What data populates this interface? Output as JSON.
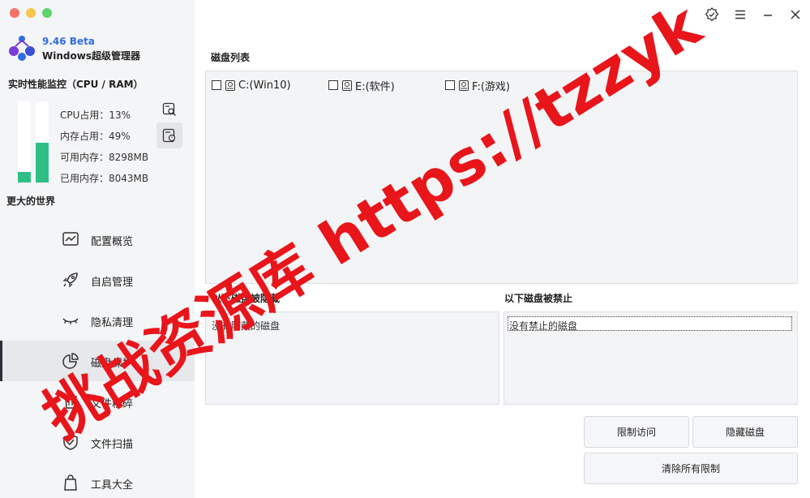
{
  "app": {
    "version": "9.46 Beta",
    "name": "Windows超级管理器"
  },
  "colors": {
    "accent": "#2f6de1",
    "meter_fill": "#2fbf85",
    "watermark": "#e8151b",
    "traffic_close": "#f3736a",
    "traffic_min": "#f6c54c",
    "traffic_max": "#5fd36e"
  },
  "monitor": {
    "title": "实时性能监控（CPU / RAM）",
    "cpu_fraction": 0.13,
    "ram_fraction": 0.49,
    "cpu_text": "CPU占用：13%",
    "ram_text": "内存占用：49%",
    "free_text": "可用内存：8298MB",
    "used_text": "已用内存：8043MB",
    "icon_1": "disk-search-icon",
    "icon_2": "disk-check-icon"
  },
  "sidebar": {
    "slogan": "更大的世界",
    "items": [
      {
        "label": "配置概览",
        "icon": "chart-icon"
      },
      {
        "label": "自启管理",
        "icon": "rocket-icon"
      },
      {
        "label": "隐私清理",
        "icon": "eye-closed-icon"
      },
      {
        "label": "磁盘保护",
        "icon": "pie-chart-icon",
        "active": true
      },
      {
        "label": "文件粉碎",
        "icon": "trash-icon"
      },
      {
        "label": "文件扫描",
        "icon": "shield-icon"
      },
      {
        "label": "工具大全",
        "icon": "bag-icon"
      }
    ]
  },
  "titlebar": {
    "icons": [
      "verified-icon",
      "menu-icon",
      "minimize-icon",
      "close-icon"
    ]
  },
  "disk_list": {
    "title": "磁盘列表",
    "disks": [
      {
        "label": "C:(Win10)",
        "checked": false
      },
      {
        "label": "E:(软件)",
        "checked": false
      },
      {
        "label": "F:(游戏)",
        "checked": false
      }
    ]
  },
  "hidden": {
    "title": "以下磁盘被隐藏",
    "empty_text": "没有隐藏的磁盘"
  },
  "disabled": {
    "title": "以下磁盘被禁止",
    "empty_text": "没有禁止的磁盘"
  },
  "buttons": {
    "restrict": "限制访问",
    "hide": "隐藏磁盘",
    "clear": "清除所有限制"
  },
  "watermark": {
    "text": "挑战资源库 https://tzzyk"
  }
}
